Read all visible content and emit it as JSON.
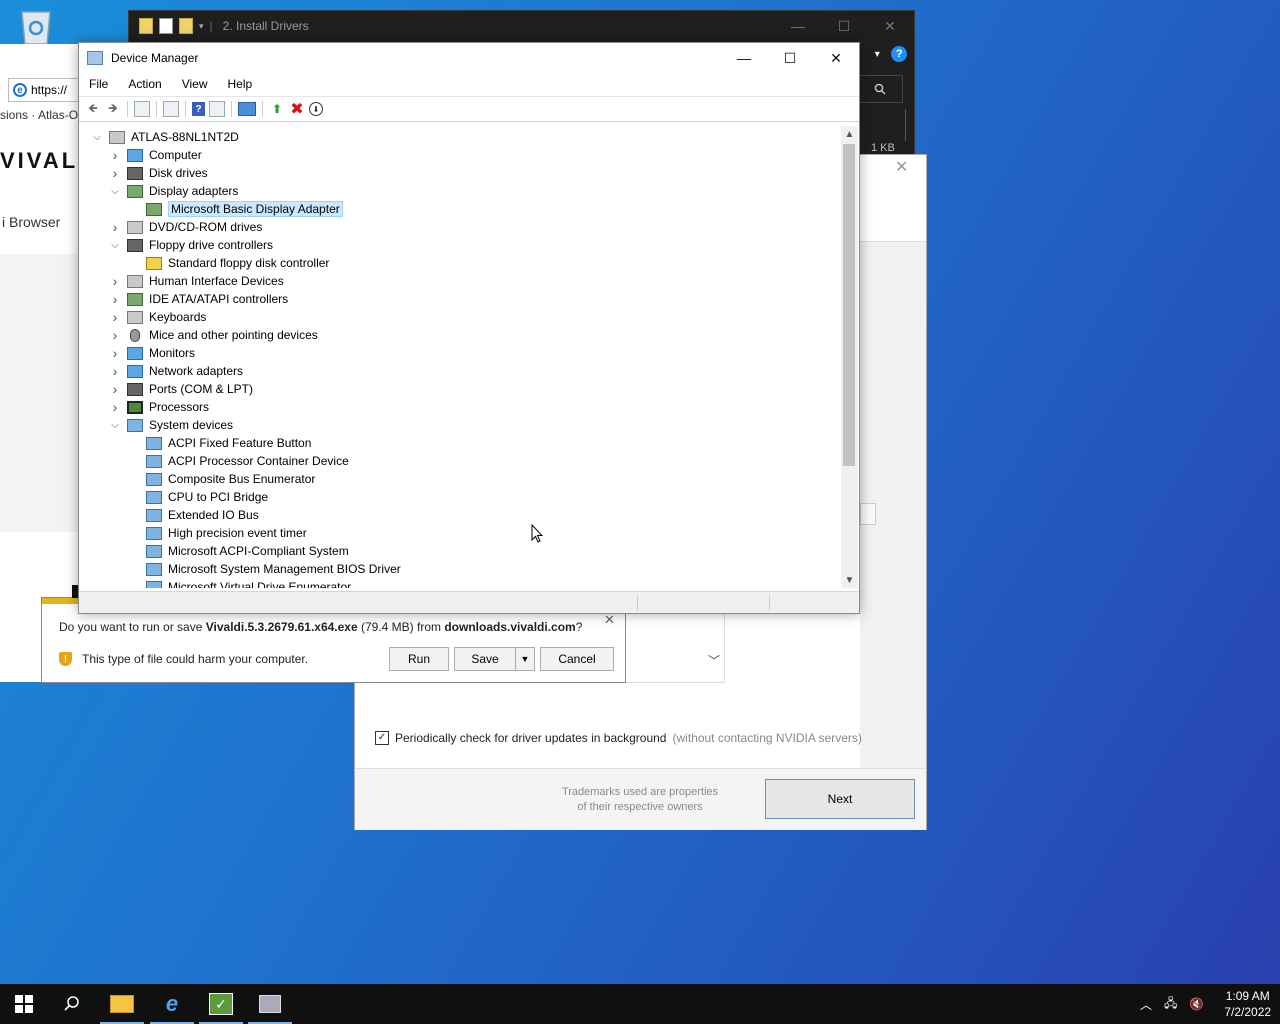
{
  "explorer": {
    "title": "2. Install Drivers",
    "size_text": "1 KB"
  },
  "browser": {
    "address": "https://",
    "breadcrumb": "sions · Atlas-O",
    "logo": "VIVAL",
    "subtitle": "i Browser"
  },
  "nvidia": {
    "checkbox_label": "Periodically check for driver updates in background",
    "checkbox_note": "(without contacting NVIDIA servers)",
    "trademark_line1": "Trademarks used are properties",
    "trademark_line2": "of their respective owners",
    "next_label": "Next"
  },
  "download": {
    "prefix": "Do you want to run or save ",
    "filename": "Vivaldi.5.3.2679.61.x64.exe",
    "size": " (79.4 MB) from ",
    "source": "downloads.vivaldi.com",
    "suffix": "?",
    "warning": "This type of file could harm your computer.",
    "run_label": "Run",
    "save_label": "Save",
    "cancel_label": "Cancel"
  },
  "devmgr": {
    "title": "Device Manager",
    "menu": [
      "File",
      "Action",
      "View",
      "Help"
    ],
    "tree": [
      {
        "label": "ATLAS-88NL1NT2D",
        "level": 0,
        "expander": "expanded",
        "icon": "computer-root-icon"
      },
      {
        "label": "Computer",
        "level": 1,
        "expander": "collapsed",
        "icon": "computer-icon"
      },
      {
        "label": "Disk drives",
        "level": 1,
        "expander": "collapsed",
        "icon": "disk-drive-icon"
      },
      {
        "label": "Display adapters",
        "level": 1,
        "expander": "expanded",
        "icon": "display-adapter-icon"
      },
      {
        "label": "Microsoft Basic Display Adapter",
        "level": 2,
        "expander": "none",
        "icon": "display-adapter-icon",
        "selected": true
      },
      {
        "label": "DVD/CD-ROM drives",
        "level": 1,
        "expander": "collapsed",
        "icon": "dvd-drive-icon"
      },
      {
        "label": "Floppy drive controllers",
        "level": 1,
        "expander": "expanded",
        "icon": "floppy-controller-icon"
      },
      {
        "label": "Standard floppy disk controller",
        "level": 2,
        "expander": "none",
        "icon": "warning-device-icon"
      },
      {
        "label": "Human Interface Devices",
        "level": 1,
        "expander": "collapsed",
        "icon": "hid-icon"
      },
      {
        "label": "IDE ATA/ATAPI controllers",
        "level": 1,
        "expander": "collapsed",
        "icon": "ide-controller-icon"
      },
      {
        "label": "Keyboards",
        "level": 1,
        "expander": "collapsed",
        "icon": "keyboard-icon"
      },
      {
        "label": "Mice and other pointing devices",
        "level": 1,
        "expander": "collapsed",
        "icon": "mouse-icon"
      },
      {
        "label": "Monitors",
        "level": 1,
        "expander": "collapsed",
        "icon": "monitor-icon"
      },
      {
        "label": "Network adapters",
        "level": 1,
        "expander": "collapsed",
        "icon": "network-adapter-icon"
      },
      {
        "label": "Ports (COM & LPT)",
        "level": 1,
        "expander": "collapsed",
        "icon": "port-icon"
      },
      {
        "label": "Processors",
        "level": 1,
        "expander": "collapsed",
        "icon": "processor-icon"
      },
      {
        "label": "System devices",
        "level": 1,
        "expander": "expanded",
        "icon": "system-devices-icon"
      },
      {
        "label": "ACPI Fixed Feature Button",
        "level": 2,
        "expander": "none",
        "icon": "system-device-icon"
      },
      {
        "label": "ACPI Processor Container Device",
        "level": 2,
        "expander": "none",
        "icon": "system-device-icon"
      },
      {
        "label": "Composite Bus Enumerator",
        "level": 2,
        "expander": "none",
        "icon": "system-device-icon"
      },
      {
        "label": "CPU to PCI Bridge",
        "level": 2,
        "expander": "none",
        "icon": "system-device-icon"
      },
      {
        "label": "Extended IO Bus",
        "level": 2,
        "expander": "none",
        "icon": "system-device-icon"
      },
      {
        "label": "High precision event timer",
        "level": 2,
        "expander": "none",
        "icon": "system-device-icon"
      },
      {
        "label": "Microsoft ACPI-Compliant System",
        "level": 2,
        "expander": "none",
        "icon": "system-device-icon"
      },
      {
        "label": "Microsoft System Management BIOS Driver",
        "level": 2,
        "expander": "none",
        "icon": "system-device-icon"
      },
      {
        "label": "Microsoft Virtual Drive Enumerator",
        "level": 2,
        "expander": "none",
        "icon": "system-device-icon"
      }
    ]
  },
  "taskbar": {
    "time": "1:09 AM",
    "date": "7/2/2022"
  }
}
